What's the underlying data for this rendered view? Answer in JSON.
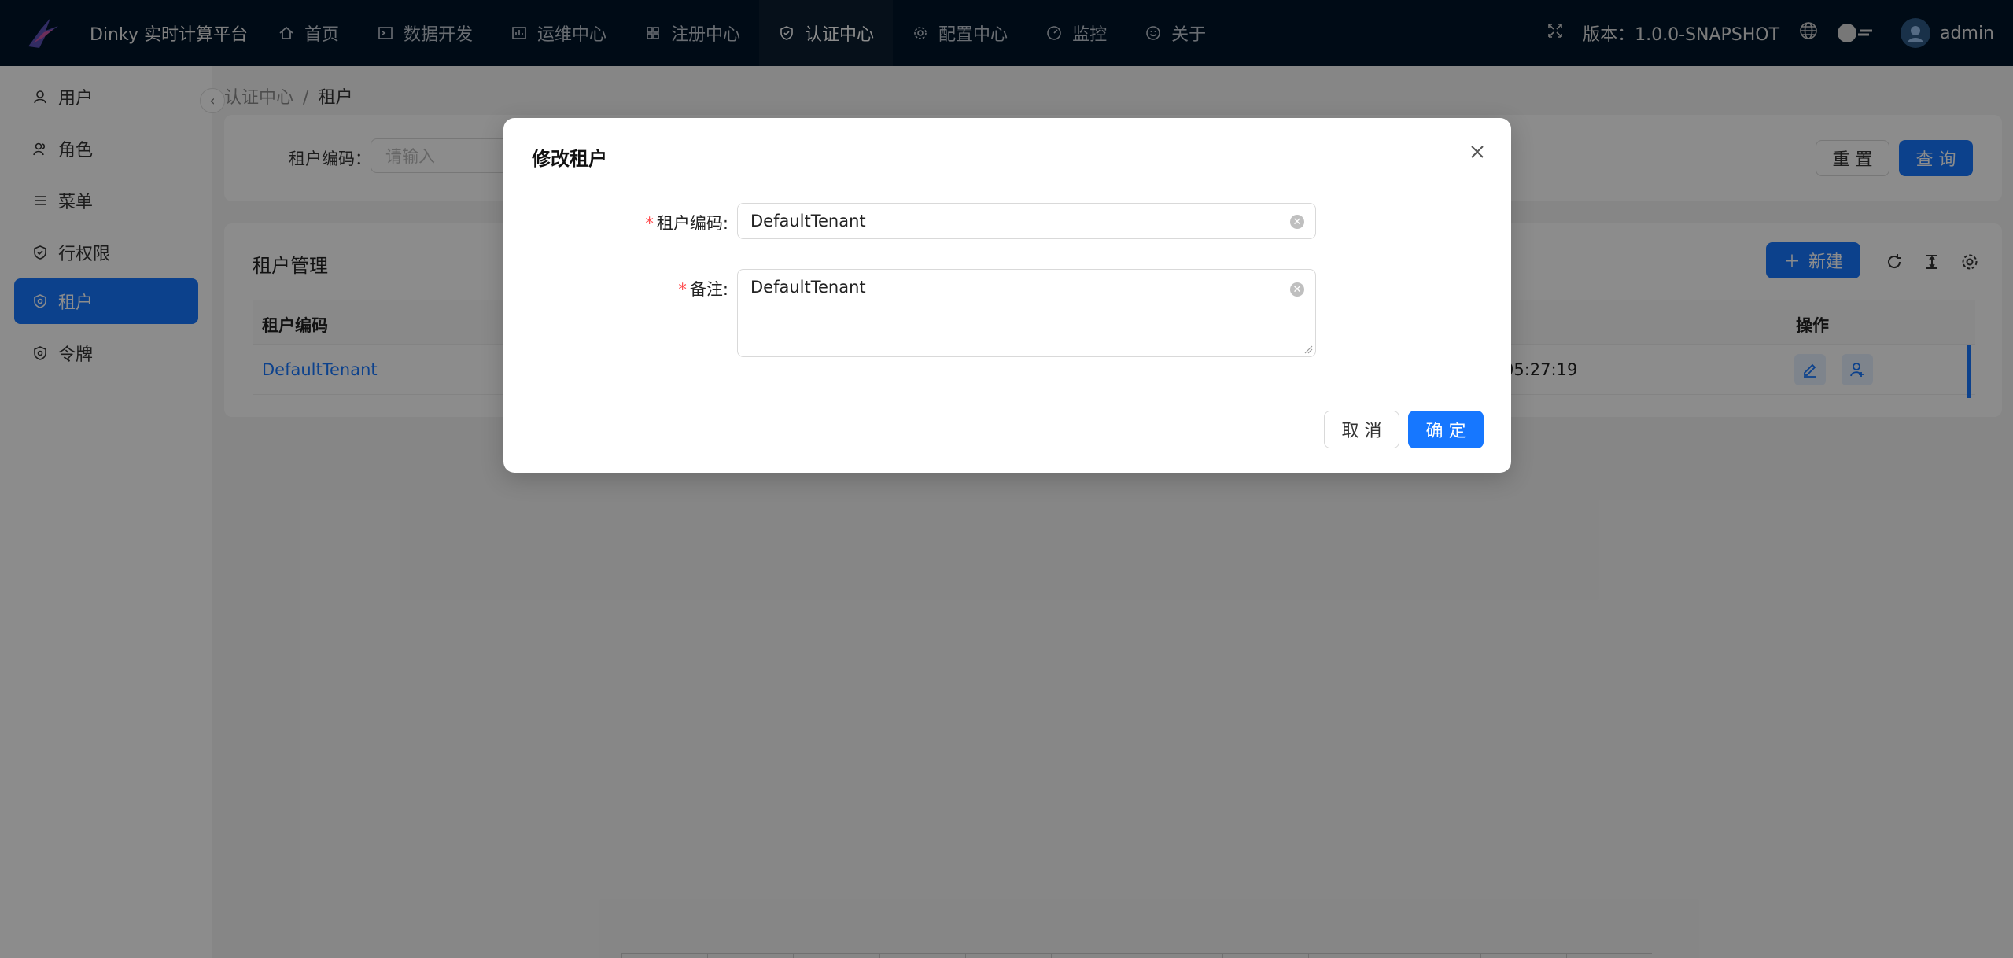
{
  "header": {
    "app_title": "Dinky 实时计算平台",
    "nav": [
      {
        "label": "首页",
        "icon": "home-icon"
      },
      {
        "label": "数据开发",
        "icon": "terminal-icon"
      },
      {
        "label": "运维中心",
        "icon": "dashboard-icon"
      },
      {
        "label": "注册中心",
        "icon": "appstore-icon"
      },
      {
        "label": "认证中心",
        "icon": "safety-icon"
      },
      {
        "label": "配置中心",
        "icon": "setting-icon"
      },
      {
        "label": "监控",
        "icon": "gauge-icon"
      },
      {
        "label": "关于",
        "icon": "smile-icon"
      }
    ],
    "version": "版本：1.0.0-SNAPSHOT",
    "user": "admin"
  },
  "sidebar": {
    "items": [
      {
        "label": "用户",
        "icon": "user-icon"
      },
      {
        "label": "角色",
        "icon": "team-icon"
      },
      {
        "label": "菜单",
        "icon": "menu-icon"
      },
      {
        "label": "行权限",
        "icon": "safety-icon"
      },
      {
        "label": "租户",
        "icon": "safety-icon"
      },
      {
        "label": "令牌",
        "icon": "safety-icon"
      }
    ],
    "selected_index": 4
  },
  "breadcrumb": {
    "parent": "认证中心",
    "current": "租户"
  },
  "search": {
    "label": "租户编码：",
    "placeholder": "请输入",
    "reset_label": "重 置",
    "query_label": "查 询"
  },
  "table": {
    "title": "租户管理",
    "new_label": "新建",
    "columns": {
      "code": "租户编码",
      "action": "操作"
    },
    "rows": [
      {
        "code": "DefaultTenant",
        "time_fragment": "05:27:19"
      }
    ]
  },
  "modal": {
    "title": "修改租户",
    "code_label": "租户编码:",
    "code_value": "DefaultTenant",
    "note_label": "备注:",
    "note_value": "DefaultTenant",
    "cancel_label": "取 消",
    "ok_label": "确 定"
  },
  "colors": {
    "primary": "#1677ff",
    "header_bg": "#001529",
    "required": "#ff4d4f"
  }
}
